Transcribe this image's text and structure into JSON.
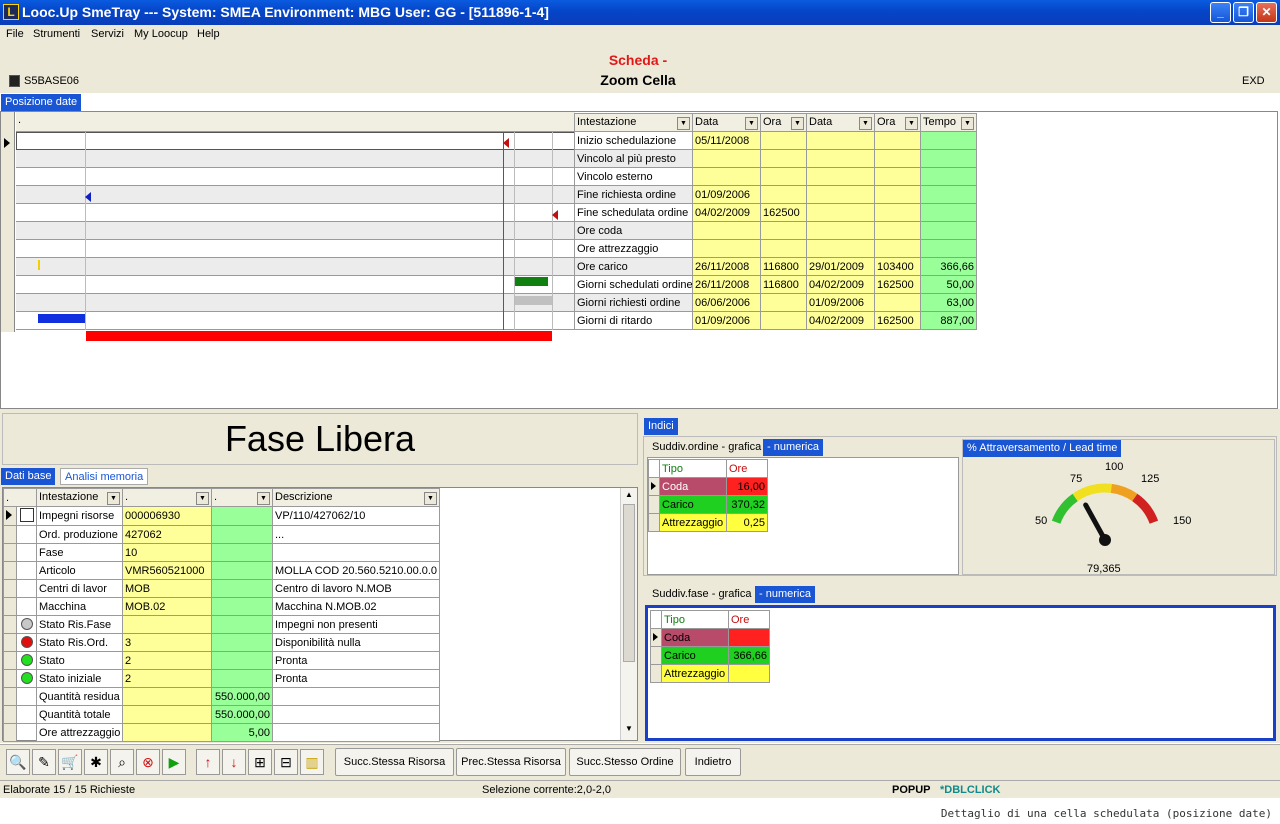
{
  "window": {
    "title": "Looc.Up SmeTray --- System: SMEA Environment: MBG User: GG - [511896-1-4]",
    "app_icon": "L"
  },
  "menu": [
    "File",
    "Strumenti",
    "Servizi",
    "My Loocup",
    "Help"
  ],
  "header": {
    "title": "Scheda -",
    "subtitle": "Zoom Cella",
    "code": "S5BASE06",
    "exd": "EXD"
  },
  "top_tab": "Posizione date",
  "top_grid": {
    "dot_header": ".",
    "columns": [
      "Intestazione",
      "Data",
      "Ora",
      "Data",
      "Ora",
      "Tempo"
    ],
    "rows": [
      [
        "Inizio schedulazione",
        "05/11/2008",
        "",
        "",
        "",
        ""
      ],
      [
        "Vincolo al più presto",
        "",
        "",
        "",
        "",
        ""
      ],
      [
        "Vincolo esterno",
        "",
        "",
        "",
        "",
        ""
      ],
      [
        "Fine richiesta ordine",
        "01/09/2006",
        "",
        "",
        "",
        ""
      ],
      [
        "Fine schedulata ordine",
        "04/02/2009",
        "162500",
        "",
        "",
        ""
      ],
      [
        "Ore coda",
        "",
        "",
        "",
        "",
        ""
      ],
      [
        "Ore attrezzaggio",
        "",
        "",
        "",
        "",
        ""
      ],
      [
        "Ore carico",
        "26/11/2008",
        "116800",
        "29/01/2009",
        "103400",
        "366,66"
      ],
      [
        "Giorni schedulati ordine",
        "26/11/2008",
        "116800",
        "04/02/2009",
        "162500",
        "50,00"
      ],
      [
        "Giorni richiesti ordine",
        "06/06/2006",
        "",
        "01/09/2006",
        "",
        "63,00"
      ],
      [
        "Giorni di ritardo",
        "01/09/2006",
        "",
        "04/02/2009",
        "162500",
        "887,00"
      ]
    ]
  },
  "fase": {
    "title": "Fase Libera"
  },
  "left_tabs": [
    "Dati base",
    "Analisi memoria"
  ],
  "left_grid": {
    "columns": [
      ".",
      "Intestazione",
      ".",
      ".",
      "Descrizione"
    ],
    "rows": [
      {
        "icon": "box",
        "label": "Impegni risorse",
        "v1": "000006930",
        "v2": "",
        "desc": "VP/110/427062/10"
      },
      {
        "icon": "",
        "label": "Ord. produzione",
        "v1": "427062",
        "v2": "",
        "desc": "..."
      },
      {
        "icon": "",
        "label": "Fase",
        "v1": "10",
        "v2": "",
        "desc": ""
      },
      {
        "icon": "",
        "label": "Articolo",
        "v1": "VMR560521000",
        "v2": "",
        "desc": "MOLLA COD 20.560.5210.00.0.0"
      },
      {
        "icon": "",
        "label": "Centri di lavor",
        "v1": "MOB",
        "v2": "",
        "desc": "Centro di lavoro N.MOB"
      },
      {
        "icon": "",
        "label": "Macchina",
        "v1": "MOB.02",
        "v2": "",
        "desc": "Macchina N.MOB.02"
      },
      {
        "icon": "grey",
        "label": "Stato Ris.Fase",
        "v1": "",
        "v2": "",
        "desc": "Impegni non presenti"
      },
      {
        "icon": "red",
        "label": "Stato Ris.Ord.",
        "v1": "3",
        "v2": "",
        "desc": "Disponibilità nulla"
      },
      {
        "icon": "green",
        "label": "Stato",
        "v1": "2",
        "v2": "",
        "desc": "Pronta"
      },
      {
        "icon": "green",
        "label": "Stato iniziale",
        "v1": "2",
        "v2": "",
        "desc": "Pronta"
      },
      {
        "icon": "",
        "label": "Quantità residua",
        "v1": "",
        "v2": "550.000,00",
        "desc": ""
      },
      {
        "icon": "",
        "label": "Quantità totale",
        "v1": "",
        "v2": "550.000,00",
        "desc": ""
      },
      {
        "icon": "",
        "label": "Ore attrezzaggio",
        "v1": "",
        "v2": "5,00",
        "desc": ""
      }
    ]
  },
  "indici": {
    "tab": "Indici",
    "ordine": {
      "tab_a": "Suddiv.ordine - grafica",
      "tab_b": "- numerica",
      "headers": [
        "Tipo",
        "Ore"
      ],
      "rows": [
        {
          "tipo": "Coda",
          "ore": "16,00"
        },
        {
          "tipo": "Carico",
          "ore": "370,32"
        },
        {
          "tipo": "Attrezzaggio",
          "ore": "0,25"
        }
      ]
    },
    "gauge": {
      "title": "% Attraversamento / Lead time",
      "labels": [
        "50",
        "75",
        "100",
        "125",
        "150"
      ],
      "value": "79,365",
      "value_num": 79.365
    },
    "fase_panel": {
      "tab_a": "Suddiv.fase - grafica",
      "tab_b": "- numerica",
      "headers": [
        "Tipo",
        "Ore"
      ],
      "rows": [
        {
          "tipo": "Coda",
          "ore": ""
        },
        {
          "tipo": "Carico",
          "ore": "366,66"
        },
        {
          "tipo": "Attrezzaggio",
          "ore": ""
        }
      ]
    }
  },
  "toolbar": {
    "buttons": [
      "Succ.Stessa Risorsa",
      "Prec.Stessa Risorsa",
      "Succ.Stesso Ordine",
      "Indietro"
    ]
  },
  "status": {
    "left": "Elaborate 15 / 15 Richieste",
    "mid": "Selezione corrente:2,0-2,0",
    "popup": "POPUP",
    "dbl": "*DBLCLICK"
  },
  "caption": "Dettaglio di una cella schedulata (posizione date)",
  "colors": {
    "accent": "#1a56d4",
    "yellow": "#ffff99",
    "green": "#99ff99",
    "red": "#ff0000"
  }
}
